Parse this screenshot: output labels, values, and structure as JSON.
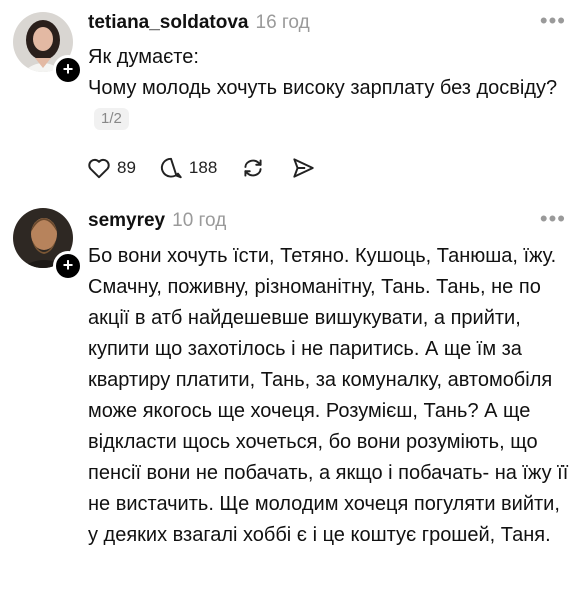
{
  "posts": [
    {
      "username": "tetiana_soldatova",
      "time": "16 год",
      "text": "Як думаєте:\nЧому молодь хочуть високу зарплату без досвіду?",
      "counter": "1/2",
      "likes": "89",
      "comments": "188",
      "avatar_icon": "woman-portrait-avatar",
      "more_icon": "ellipsis-icon"
    },
    {
      "username": "semyrey",
      "time": "10 год",
      "text": "Бо вони хочуть їсти, Тетяно. Кушоць, Танюша, їжу. Смачну, поживну, різноманітну, Тань. Тань, не по акції в атб найдешевше вишукувати, а прийти, купити що захотілось і не паритись.  А ще їм за квартиру платити, Тань, за комуналку, автомобіля може якогось ще хочеця. Розумієш, Тань? А ще відкласти щось хочеться, бо вони розуміють, що пенсії вони не побачать, а якщо і побачать- на їжу її не вистачить. Ще молодим хочеця погуляти вийти, у деяких взагалі хоббі є і це коштує грошей, Таня.",
      "avatar_icon": "bearded-man-avatar",
      "more_icon": "ellipsis-icon"
    }
  ],
  "icons": {
    "like": "heart-icon",
    "comment": "speech-bubble-icon",
    "repost": "repost-arrows-icon",
    "share": "send-arrow-icon",
    "follow": "plus-icon"
  },
  "colors": {
    "text": "#111111",
    "muted": "#9a9a9a",
    "badge": "#000000"
  }
}
